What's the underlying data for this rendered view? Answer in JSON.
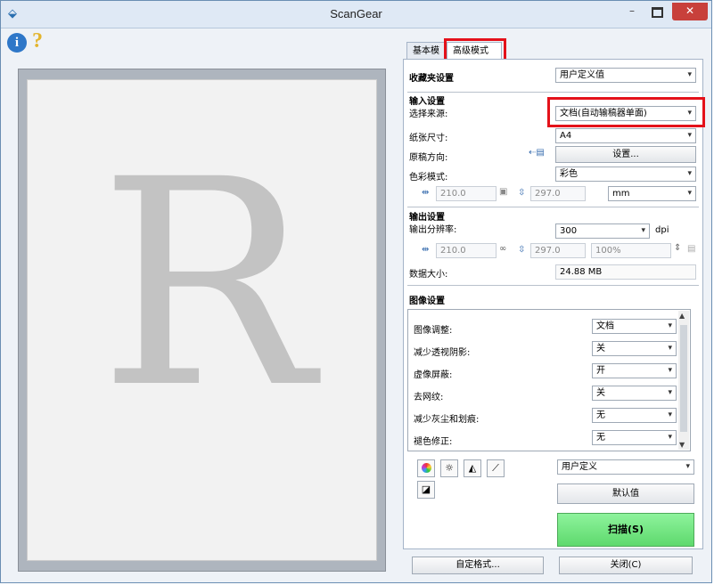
{
  "window": {
    "title": "ScanGear",
    "minimize": "–",
    "close": "✕",
    "app_icon": "scanner-icon"
  },
  "toolbar": {
    "info": "i",
    "help": "?"
  },
  "preview": {
    "letter": "R"
  },
  "tabs": {
    "basic": "基本模式",
    "advanced": "高级模式"
  },
  "favorite": {
    "label": "收藏夹设置",
    "value": "用户定义值"
  },
  "input": {
    "header": "输入设置",
    "source_label": "选择来源:",
    "source_value": "文档(自动输稿器单面)",
    "paper_label": "纸张尺寸:",
    "paper_value": "A4",
    "orientation_label": "原稿方向:",
    "orientation_btn": "设置...",
    "color_label": "色彩模式:",
    "color_value": "彩色",
    "width": "210.0",
    "height": "297.0",
    "unit": "mm"
  },
  "output": {
    "header": "输出设置",
    "resolution_label": "输出分辨率:",
    "resolution_value": "300",
    "resolution_unit": "dpi",
    "width": "210.0",
    "height": "297.0",
    "scale": "100%",
    "datasize_label": "数据大小:",
    "datasize_value": "24.88 MB"
  },
  "image": {
    "header": "图像设置",
    "items": [
      {
        "label": "图像调整:",
        "value": "文档"
      },
      {
        "label": "减少透视阴影:",
        "value": "关"
      },
      {
        "label": "虚像屏蔽:",
        "value": "开"
      },
      {
        "label": "去网纹:",
        "value": "关"
      },
      {
        "label": "减少灰尘和划痕:",
        "value": "无"
      },
      {
        "label": "褪色修正:",
        "value": "无"
      }
    ]
  },
  "tone": {
    "preset": "用户定义",
    "defaults_btn": "默认值"
  },
  "scan_btn": "扫描(S)",
  "custom_btn": "自定格式...",
  "close_btn": "关闭(C)"
}
